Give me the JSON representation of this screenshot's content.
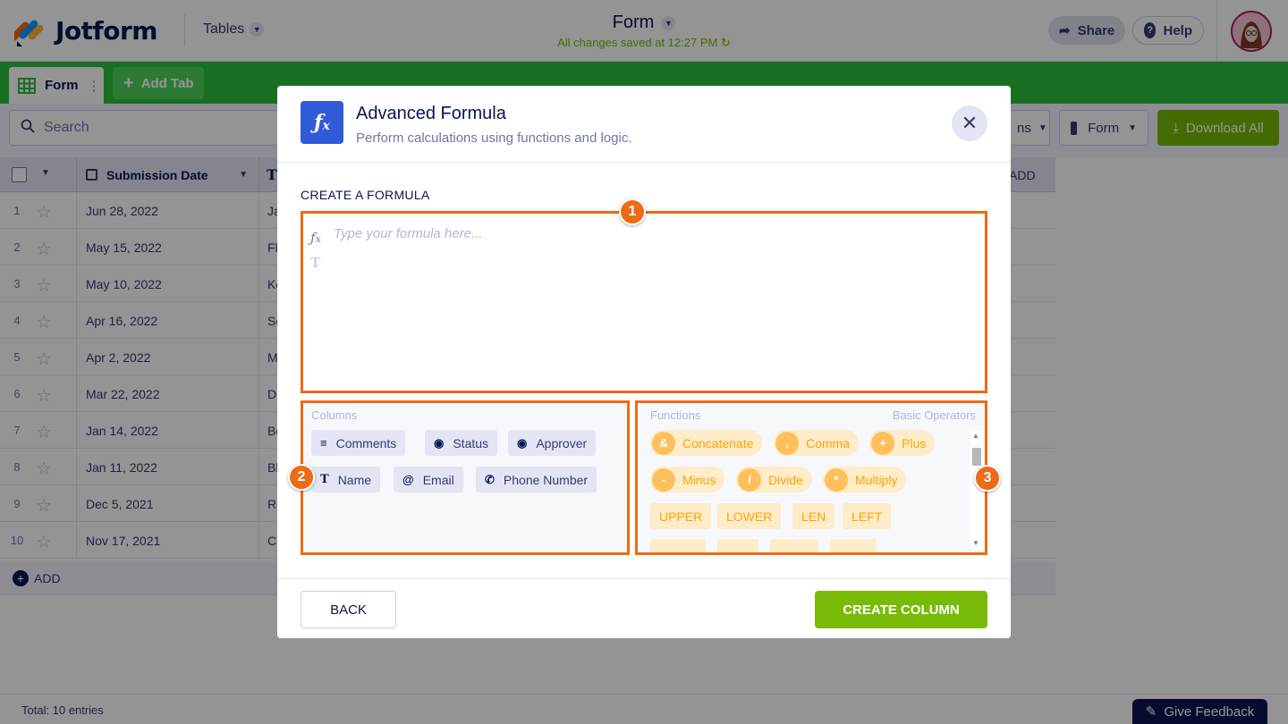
{
  "header": {
    "brand": "Jotform",
    "tables_label": "Tables",
    "form_title": "Form",
    "saved_status": "All changes saved at 12:27 PM",
    "share_label": "Share",
    "help_label": "Help"
  },
  "tabs": {
    "active_tab": "Form",
    "add_tab": "Add Tab"
  },
  "toolbar": {
    "search_placeholder": "Search",
    "columns_label": "ns",
    "form_dropdown": "Form",
    "download_label": "Download All"
  },
  "table": {
    "date_header": "Submission Date",
    "add_column": "ADD",
    "rows": [
      {
        "num": "1",
        "date": "Jun 28, 2022",
        "text": "Ja"
      },
      {
        "num": "2",
        "date": "May 15, 2022",
        "text": "Fl"
      },
      {
        "num": "3",
        "date": "May 10, 2022",
        "text": "Ke"
      },
      {
        "num": "4",
        "date": "Apr 16, 2022",
        "text": "Sc"
      },
      {
        "num": "5",
        "date": "Apr 2, 2022",
        "text": "M"
      },
      {
        "num": "6",
        "date": "Mar 22, 2022",
        "text": "D"
      },
      {
        "num": "7",
        "date": "Jan 14, 2022",
        "text": "Bo"
      },
      {
        "num": "8",
        "date": "Jan 11, 2022",
        "text": "Bl"
      },
      {
        "num": "9",
        "date": "Dec 5, 2021",
        "text": "Ro"
      },
      {
        "num": "10",
        "date": "Nov 17, 2021",
        "text": "C"
      }
    ],
    "add_row": "ADD",
    "total": "Total: 10 entries"
  },
  "feedback_label": "Give Feedback",
  "modal": {
    "title": "Advanced Formula",
    "subtitle": "Perform calculations using functions and logic.",
    "section_label": "CREATE A FORMULA",
    "formula_placeholder": "Type your formula here...",
    "columns_heading": "Columns",
    "columns": [
      {
        "icon": "text-lines-icon",
        "label": "Comments"
      },
      {
        "icon": "tag-icon",
        "label": "Status"
      },
      {
        "icon": "tag-icon",
        "label": "Approver"
      },
      {
        "icon": "text-t-icon",
        "label": "Name"
      },
      {
        "icon": "at-icon",
        "label": "Email"
      },
      {
        "icon": "phone-icon",
        "label": "Phone Number"
      }
    ],
    "functions_heading": "Functions",
    "operators_heading": "Basic Operators",
    "operators": [
      {
        "symbol": "&",
        "label": "Concatenate"
      },
      {
        "symbol": ",",
        "label": "Comma"
      },
      {
        "symbol": "+",
        "label": "Plus"
      },
      {
        "symbol": "-",
        "label": "Minus"
      },
      {
        "symbol": "/",
        "label": "Divide"
      },
      {
        "symbol": "*",
        "label": "Multiply"
      }
    ],
    "functions": [
      "UPPER",
      "LOWER",
      "LEN",
      "LEFT"
    ],
    "back_label": "BACK",
    "create_label": "CREATE COLUMN"
  },
  "markers": [
    "1",
    "2",
    "3"
  ],
  "colors": {
    "accent_green": "#78bb07",
    "tab_green": "#28c23c",
    "highlight_orange": "#ec6b16",
    "brand_navy": "#0a1551",
    "fx_blue": "#2f5bd8"
  }
}
